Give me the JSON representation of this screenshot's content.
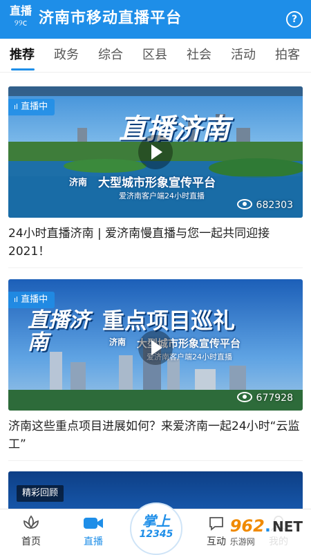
{
  "header": {
    "logo_text": "直播",
    "logo_swirl": "୨୨c",
    "title": "济南市移动直播平台",
    "help_label": "?"
  },
  "tabs": [
    {
      "label": "推荐",
      "active": true
    },
    {
      "label": "政务",
      "active": false
    },
    {
      "label": "综合",
      "active": false
    },
    {
      "label": "区县",
      "active": false
    },
    {
      "label": "社会",
      "active": false
    },
    {
      "label": "活动",
      "active": false
    },
    {
      "label": "拍客",
      "active": false
    }
  ],
  "cards": [
    {
      "badge": "直播中",
      "overlay_title": "直播济南",
      "overlay_logo": "济南",
      "overlay_slogan": "大型城市形象宣传平台",
      "overlay_subslogan": "爱济南客户端24小时直播",
      "views": "682303",
      "title": "24小时直播济南 | 爱济南慢直播与您一起共同迎接2021！"
    },
    {
      "badge": "直播中",
      "overlay_title": "直播济南",
      "overlay_heading": "重点项目巡礼",
      "overlay_logo": "济南",
      "overlay_slogan": "大型城市形象宣传平台",
      "overlay_subslogan": "爱济南客户端24小时直播",
      "views": "677928",
      "title": "济南这些重点项目进展如何？来爱济南一起24小时“云监工”"
    }
  ],
  "replay": {
    "badge": "精彩回顾"
  },
  "bottom_nav": {
    "items": [
      {
        "label": "首页",
        "icon": "lotus-icon",
        "active": false
      },
      {
        "label": "直播",
        "icon": "video-camera-icon",
        "active": true
      },
      {
        "label": "互动",
        "icon": "chat-icon",
        "active": false
      },
      {
        "label": "我的",
        "icon": "user-icon",
        "active": false
      }
    ],
    "center": {
      "top": "掌上",
      "number": "12345"
    }
  },
  "watermark": {
    "num": "962",
    "dot": ".",
    "net": "NET",
    "cn": "乐游网"
  },
  "colors": {
    "accent": "#1e8ee8",
    "text": "#222222"
  }
}
